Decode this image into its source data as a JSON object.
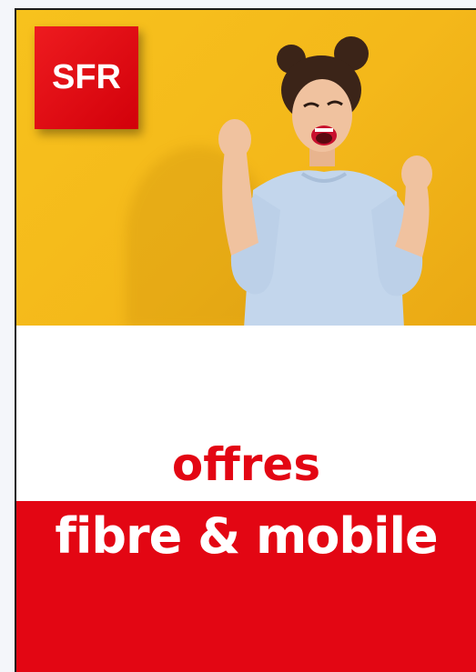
{
  "brand": {
    "logo_text": "SFR",
    "primary_color": "#e30613",
    "hero_background": "#f5bd1c"
  },
  "ad": {
    "headline_top": "offres",
    "headline_bottom": "fibre & mobile"
  },
  "icons": {
    "logo": "sfr-logo-icon",
    "photo": "celebrating-woman-photo"
  }
}
